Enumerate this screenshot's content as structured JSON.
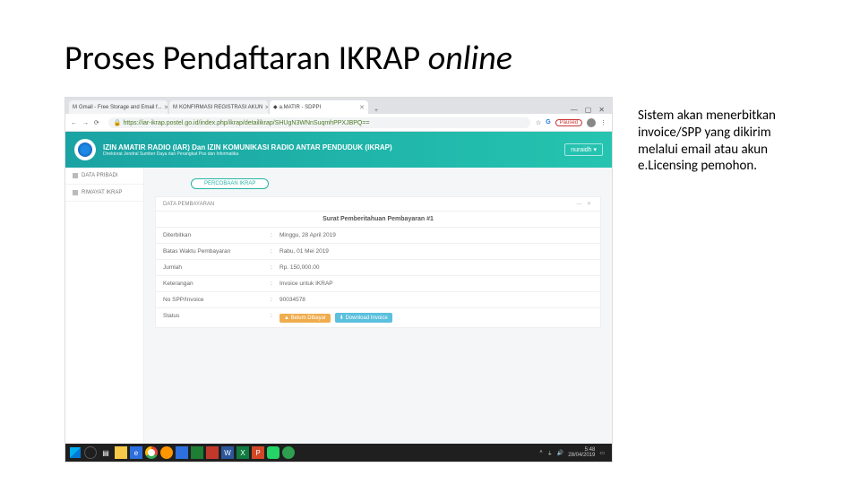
{
  "slide": {
    "title_main": "Proses Pendaftaran IKRAP ",
    "title_italic": "online",
    "annotation": "Sistem akan menerbitkan invoice/SPP yang dikirim melalui email atau akun e.Licensing pemohon."
  },
  "browser": {
    "tabs": [
      {
        "label": "Gmail - Free Storage and Email f..."
      },
      {
        "label": "KONFIRMASI REGISTRASI AKUN"
      },
      {
        "label": "a.MATIR - SDPPI"
      }
    ],
    "new_tab": "+",
    "window_controls": {
      "min": "—",
      "max": "▢",
      "close": "✕"
    },
    "nav": {
      "back": "←",
      "fwd": "→",
      "reload": "⟳"
    },
    "secure_icon": "🔒",
    "url": "https://iar-ikrap.postel.go.id/index.php/ikrap/detailikrap/SHUgN3WNnSuqmhPPXJBPQ==",
    "star": "☆",
    "paused": "Paused",
    "g_icon": "G",
    "menu": "⋮"
  },
  "site": {
    "header_line1": "IZIN AMATIR RADIO (IAR) Dan IZIN KOMUNIKASI RADIO ANTAR PENDUDUK (IKRAP)",
    "header_line2": "Direktorat Jendral Sumber Daya dan Perangkat Pos dan Informatika",
    "user_chip": "nuraidh ▾",
    "sidebar": {
      "brand": "",
      "items": [
        {
          "label": "DATA PRIBADI"
        },
        {
          "label": "RIWAYAT IKRAP"
        }
      ]
    },
    "top_button": "PERCOBAAN IKRAP",
    "panel": {
      "title": "DATA PEMBAYARAN",
      "actions": "—  ✕",
      "subtitle": "Surat Pemberitahuan Pembayaran #1",
      "rows": [
        {
          "label": "Diterbitkan",
          "value": "Minggu, 28 April 2019"
        },
        {
          "label": "Batas Waktu Pembayaran",
          "value": "Rabu, 01 Mei 2019"
        },
        {
          "label": "Jumlah",
          "value": "Rp. 150,000.00"
        },
        {
          "label": "Keterangan",
          "value": "Invoice untuk IKRAP"
        },
        {
          "label": "No SPP/Invoice",
          "value": "90034578"
        }
      ],
      "status": {
        "label": "Status",
        "badge_warn": "▲ Belum Dibayar",
        "badge_download": "⬇ Download Invoice"
      }
    }
  },
  "taskbar": {
    "time": "5:48",
    "date": "28/04/2019",
    "tray_up": "˄"
  }
}
